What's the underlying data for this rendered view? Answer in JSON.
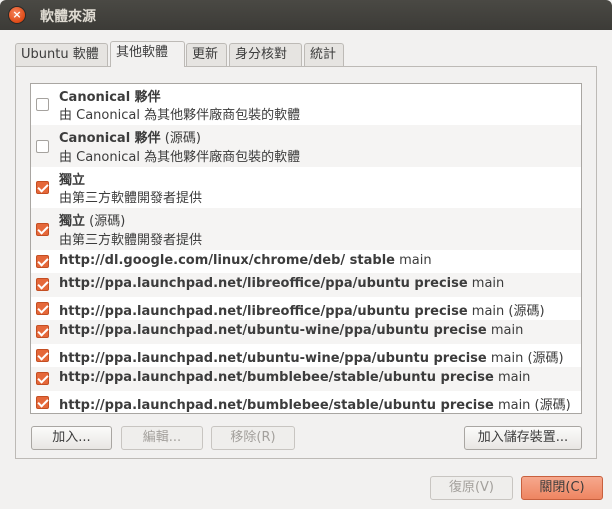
{
  "window": {
    "title": "軟體來源"
  },
  "tabs": [
    "Ubuntu 軟體",
    "其他軟體",
    "更新",
    "身分核對",
    "統計"
  ],
  "active_tab": 1,
  "sources": [
    {
      "checked": false,
      "name": "Canonical 夥伴",
      "suffix": "",
      "desc": "由 Canonical 為其他夥伴廠商包裝的軟體"
    },
    {
      "checked": false,
      "name": "Canonical 夥伴",
      "suffix": " (源碼)",
      "desc": "由 Canonical 為其他夥伴廠商包裝的軟體"
    },
    {
      "checked": true,
      "name": "獨立",
      "suffix": "",
      "desc": "由第三方軟體開發者提供"
    },
    {
      "checked": true,
      "name": "獨立",
      "suffix": " (源碼)",
      "desc": "由第三方軟體開發者提供"
    },
    {
      "checked": true,
      "name": "http://dl.google.com/linux/chrome/deb/ stable",
      "suffix": " main",
      "desc": ""
    },
    {
      "checked": true,
      "name": "http://ppa.launchpad.net/libreoffice/ppa/ubuntu precise",
      "suffix": " main",
      "desc": ""
    },
    {
      "checked": true,
      "name": "http://ppa.launchpad.net/libreoffice/ppa/ubuntu precise",
      "suffix": " main (源碼)",
      "desc": ""
    },
    {
      "checked": true,
      "name": "http://ppa.launchpad.net/ubuntu-wine/ppa/ubuntu precise",
      "suffix": " main",
      "desc": ""
    },
    {
      "checked": true,
      "name": "http://ppa.launchpad.net/ubuntu-wine/ppa/ubuntu precise",
      "suffix": " main (源碼)",
      "desc": ""
    },
    {
      "checked": true,
      "name": "http://ppa.launchpad.net/bumblebee/stable/ubuntu precise",
      "suffix": " main",
      "desc": ""
    },
    {
      "checked": true,
      "name": "http://ppa.launchpad.net/bumblebee/stable/ubuntu precise",
      "suffix": " main (源碼)",
      "desc": ""
    }
  ],
  "buttons": {
    "add": "加入...",
    "edit": "編輯...",
    "remove": "移除(R)",
    "add_volume": "加入儲存裝置...",
    "revert": "復原(V)",
    "close": "關閉(C)"
  },
  "colors": {
    "accent": "#e5683a",
    "titlebar": "#3c3b37"
  }
}
